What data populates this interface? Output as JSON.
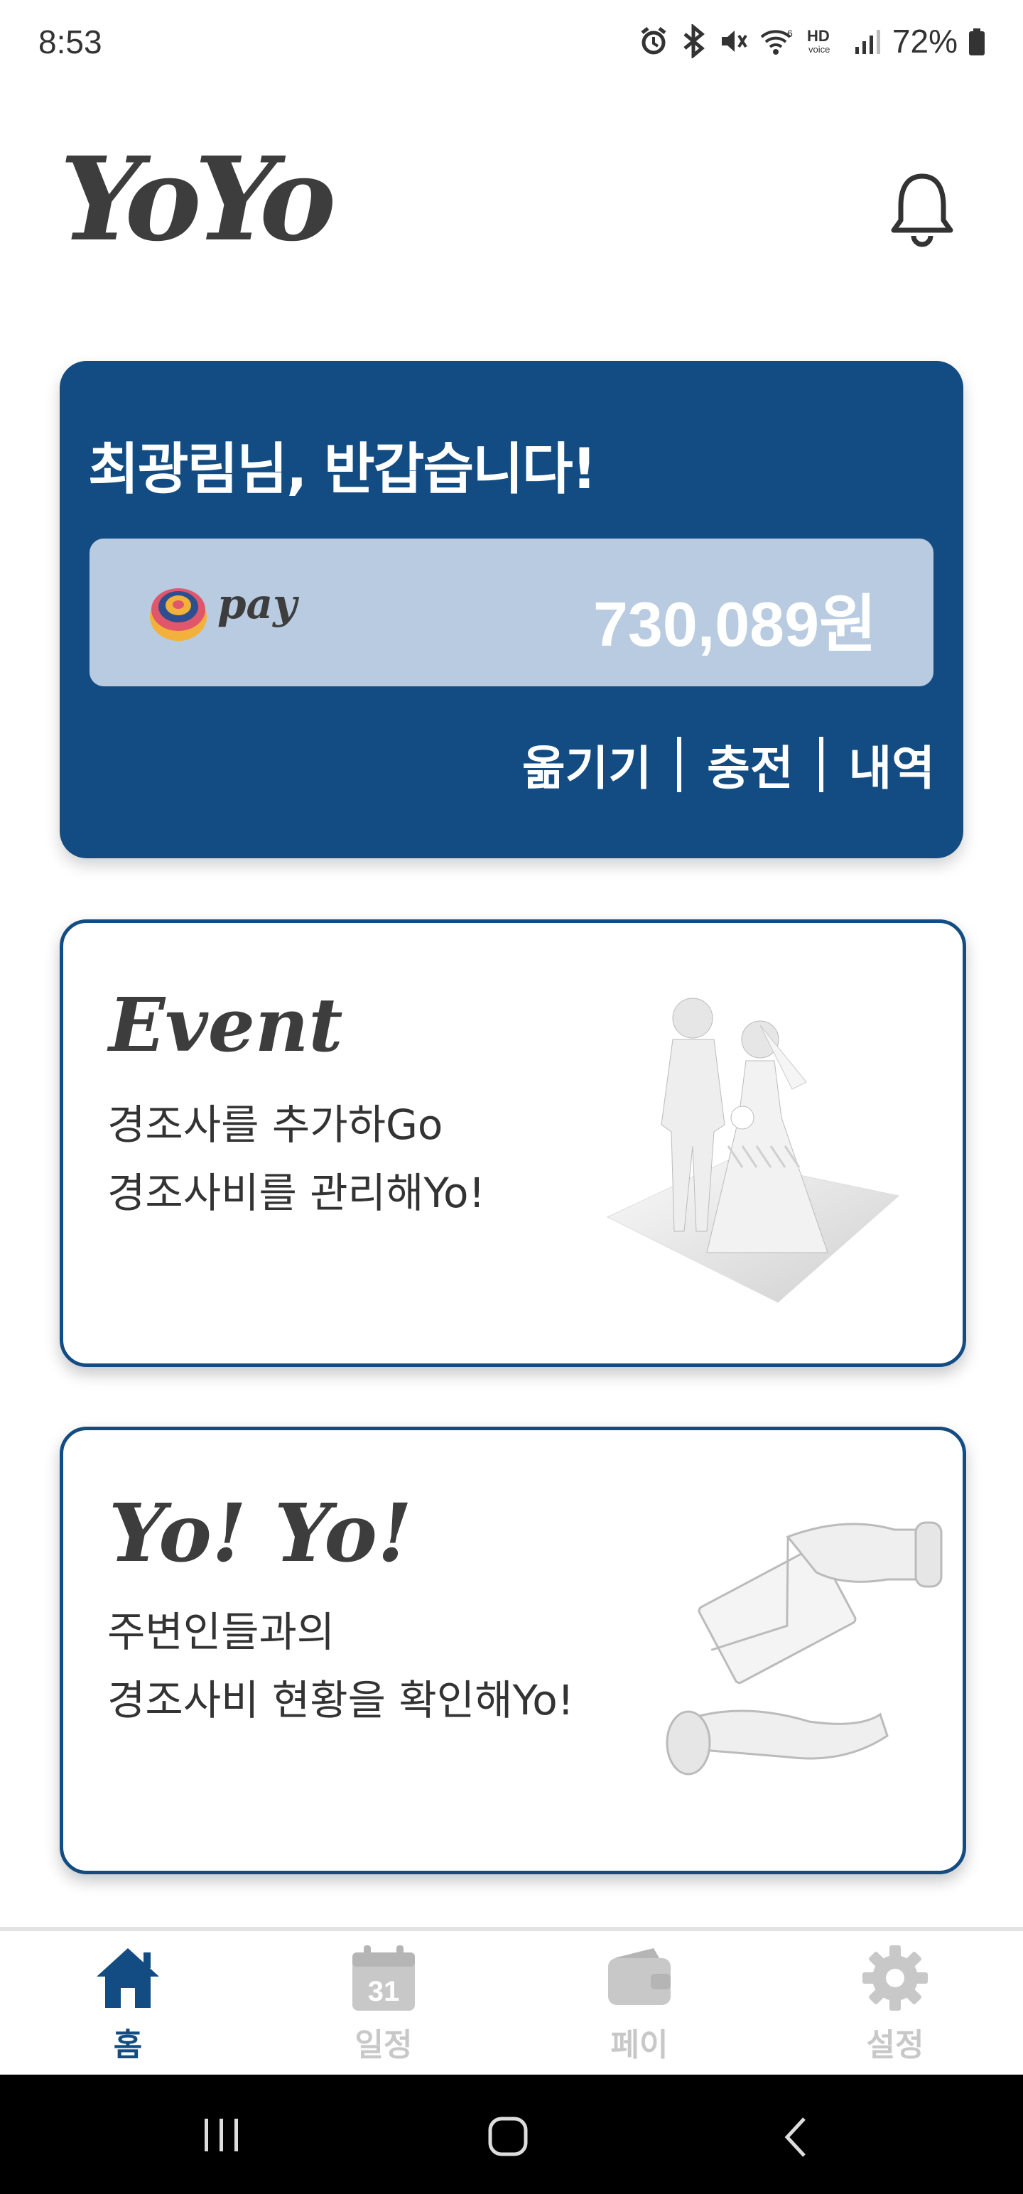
{
  "status_bar": {
    "time": "8:53",
    "battery": "72%"
  },
  "header": {
    "logo": "YoYo"
  },
  "pay_card": {
    "greeting": "최광림님, 반갑습니다!",
    "pay_label": "pay",
    "balance": "730,089원",
    "actions": [
      "옮기기",
      "충전",
      "내역"
    ]
  },
  "cards": [
    {
      "title": "Event",
      "lines": [
        "경조사를 추가하Go",
        "경조사비를 관리해Yo!"
      ]
    },
    {
      "title": "Yo! Yo!",
      "lines": [
        "주변인들과의",
        "경조사비 현황을 확인해Yo!"
      ]
    }
  ],
  "nav": [
    {
      "label": "홈",
      "icon": "home-icon",
      "active": true
    },
    {
      "label": "일정",
      "icon": "calendar-icon",
      "calendar_day": "31",
      "active": false
    },
    {
      "label": "페이",
      "icon": "wallet-icon",
      "active": false
    },
    {
      "label": "설정",
      "icon": "gear-icon",
      "active": false
    }
  ],
  "colors": {
    "primary": "#134c82",
    "pay_box": "#b8cbe0",
    "nav_active": "#134c82",
    "nav_inactive": "#c8c8c8"
  }
}
